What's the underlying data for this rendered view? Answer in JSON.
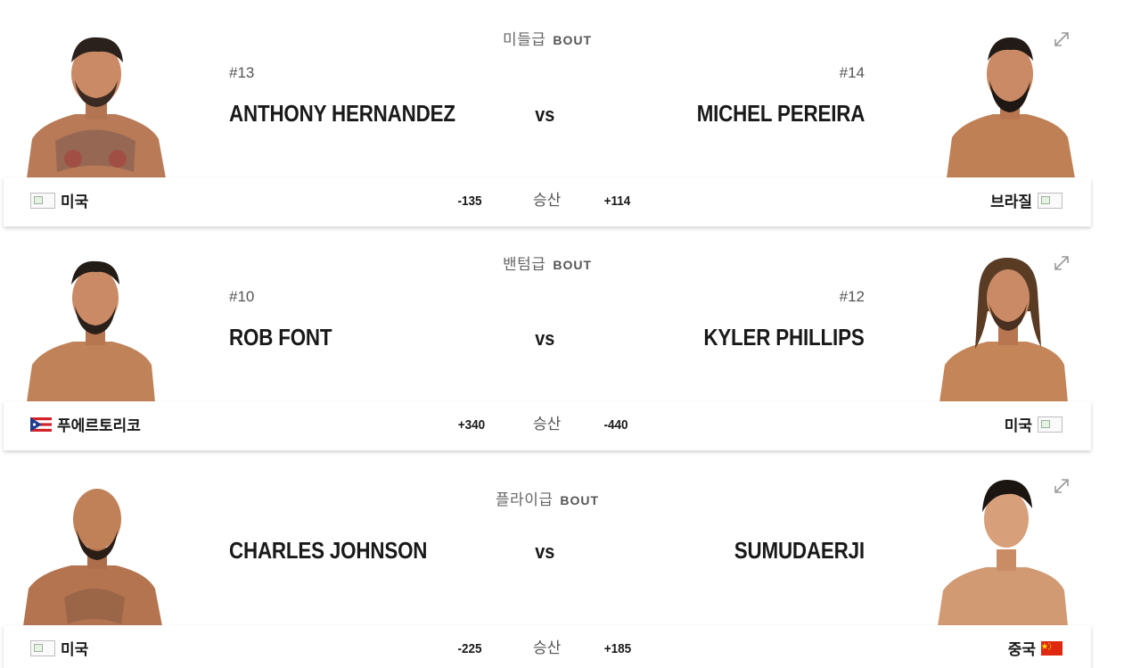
{
  "bouts": [
    {
      "weight_class": "미들급",
      "bout_label": "BOUT",
      "red": {
        "rank": "#13",
        "name": "ANTHONY HERNANDEZ",
        "country": "미국",
        "odds": "-135"
      },
      "blue": {
        "rank": "#14",
        "name": "MICHEL PEREIRA",
        "country": "브라질",
        "odds": "+114"
      },
      "vs": "vs",
      "odds_label": "승산"
    },
    {
      "weight_class": "밴텀급",
      "bout_label": "BOUT",
      "red": {
        "rank": "#10",
        "name": "ROB FONT",
        "country": "푸에르토리코",
        "odds": "+340"
      },
      "blue": {
        "rank": "#12",
        "name": "KYLER PHILLIPS",
        "country": "미국",
        "odds": "-440"
      },
      "vs": "vs",
      "odds_label": "승산"
    },
    {
      "weight_class": "플라이급",
      "bout_label": "BOUT",
      "red": {
        "rank": "",
        "name": "CHARLES JOHNSON",
        "country": "미국",
        "odds": "-225"
      },
      "blue": {
        "rank": "",
        "name": "SUMUDAERJI",
        "country": "중국",
        "odds": "+185"
      },
      "vs": "vs",
      "odds_label": "승산"
    }
  ],
  "icons": {
    "expand": "expand-arrows-icon"
  },
  "colors": {
    "text": "#191919",
    "muted": "#555555",
    "skin": "#c98a65"
  }
}
